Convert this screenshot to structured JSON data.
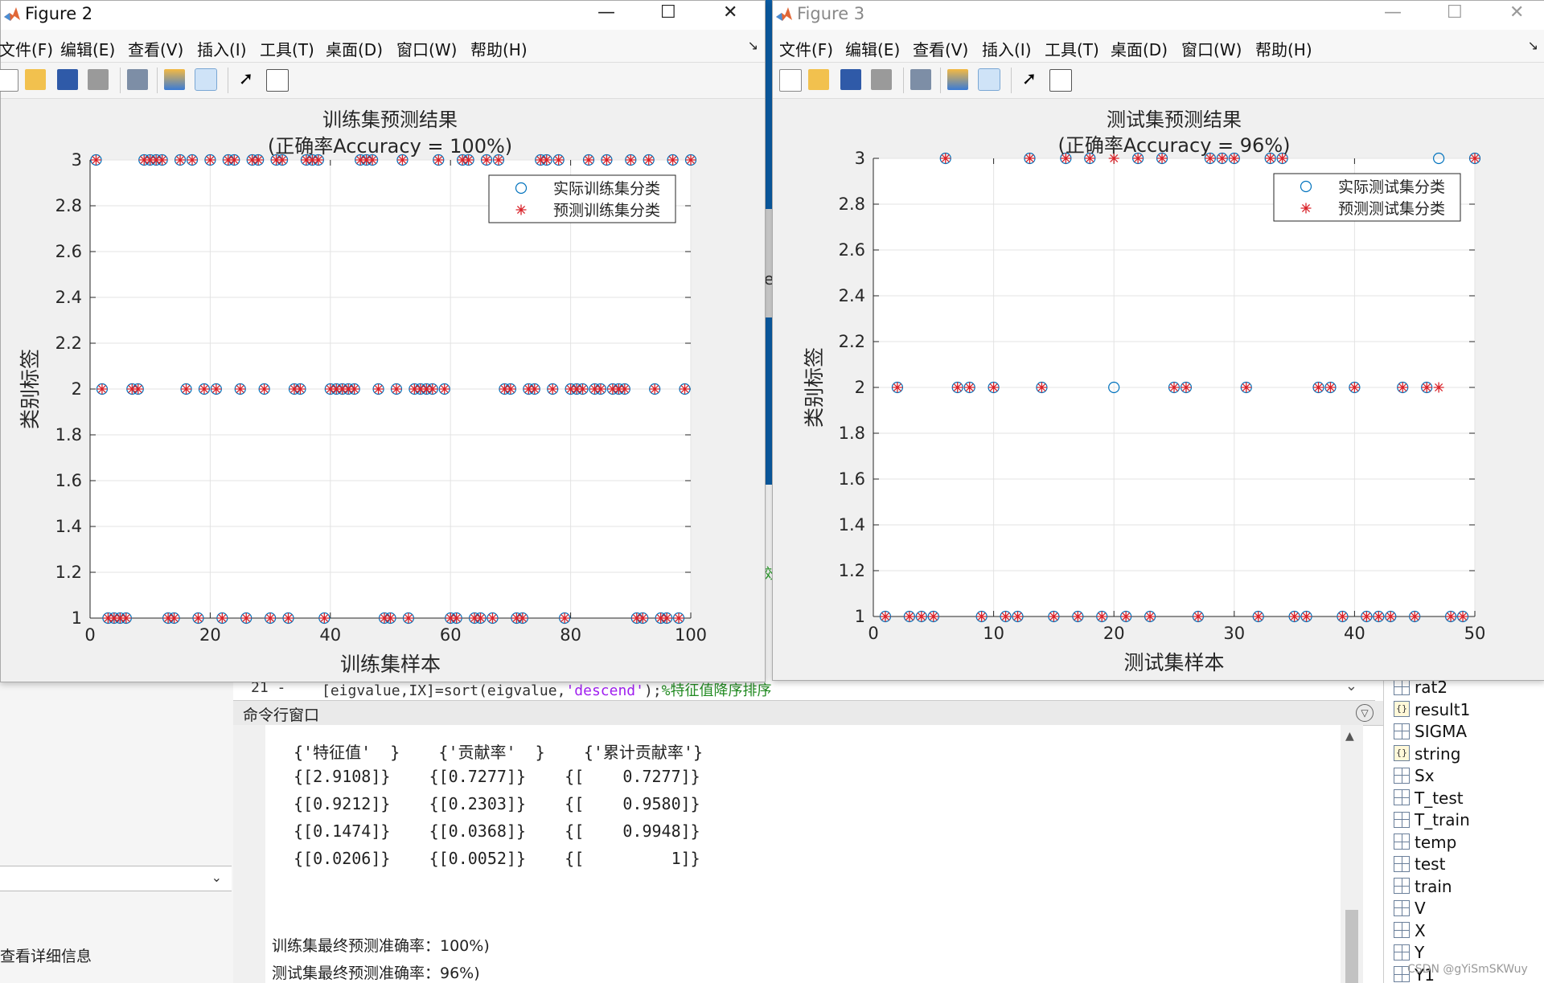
{
  "figures": [
    {
      "window_title": "Figure 2",
      "menu": [
        "文件(F)",
        "编辑(E)",
        "查看(V)",
        "插入(I)",
        "工具(T)",
        "桌面(D)",
        "窗口(W)",
        "帮助(H)"
      ],
      "plot_title_line1": "训练集预测结果",
      "plot_title_line2": "(正确率Accuracy = 100%)",
      "xlabel": "训练集样本",
      "ylabel": "类别标签",
      "legend_actual": "实际训练集分类",
      "legend_predicted": "预测训练集分类"
    },
    {
      "window_title": "Figure 3",
      "menu": [
        "文件(F)",
        "编辑(E)",
        "查看(V)",
        "插入(I)",
        "工具(T)",
        "桌面(D)",
        "窗口(W)",
        "帮助(H)"
      ],
      "plot_title_line1": "测试集预测结果",
      "plot_title_line2": "(正确率Accuracy = 96%)",
      "xlabel": "测试集样本",
      "ylabel": "类别标签",
      "legend_actual": "实际测试集分类",
      "legend_predicted": "预测测试集分类"
    }
  ],
  "chart_data": [
    {
      "type": "scatter",
      "title": "训练集预测结果 (正确率Accuracy = 100%)",
      "xlabel": "训练集样本",
      "ylabel": "类别标签",
      "xlim": [
        0,
        100
      ],
      "ylim": [
        1,
        3
      ],
      "xticks": [
        0,
        20,
        40,
        60,
        80,
        100
      ],
      "yticks": [
        1,
        1.2,
        1.4,
        1.6,
        1.8,
        2,
        2.2,
        2.4,
        2.6,
        2.8,
        3
      ],
      "grid": true,
      "legend_position": "top-right",
      "series": [
        {
          "name": "实际训练集分类",
          "marker": "circle",
          "color": "#0072bd",
          "x": [
            1,
            2,
            3,
            4,
            5,
            6,
            7,
            8,
            9,
            10,
            11,
            12,
            13,
            14,
            15,
            16,
            17,
            18,
            19,
            20,
            21,
            22,
            23,
            24,
            25,
            26,
            27,
            28,
            29,
            30,
            31,
            32,
            33,
            34,
            35,
            36,
            37,
            38,
            39,
            40,
            41,
            42,
            43,
            44,
            45,
            46,
            47,
            48,
            49,
            50,
            51,
            52,
            53,
            54,
            55,
            56,
            57,
            58,
            59,
            60,
            61,
            62,
            63,
            64,
            65,
            66,
            67,
            68,
            69,
            70,
            71,
            72,
            73,
            74,
            75,
            76,
            77,
            78,
            79,
            80,
            81,
            82,
            83,
            84,
            85,
            86,
            87,
            88,
            89,
            90,
            91,
            92,
            93,
            94,
            95,
            96,
            97,
            98,
            99,
            100
          ],
          "y": [
            3,
            2,
            1,
            1,
            1,
            1,
            2,
            2,
            3,
            3,
            3,
            3,
            1,
            1,
            3,
            2,
            3,
            1,
            2,
            3,
            2,
            1,
            3,
            3,
            2,
            1,
            3,
            3,
            2,
            1,
            3,
            3,
            1,
            2,
            2,
            3,
            3,
            3,
            1,
            2,
            2,
            2,
            2,
            2,
            3,
            3,
            3,
            2,
            1,
            1,
            2,
            3,
            1,
            2,
            2,
            2,
            2,
            3,
            2,
            1,
            1,
            3,
            3,
            1,
            1,
            3,
            1,
            3,
            2,
            2,
            1,
            1,
            2,
            2,
            3,
            3,
            2,
            3,
            1,
            2,
            2,
            2,
            3,
            2,
            2,
            3,
            2,
            2,
            2,
            3,
            1,
            1,
            3,
            2,
            1,
            1,
            3,
            1,
            2,
            3
          ]
        },
        {
          "name": "预测训练集分类",
          "marker": "asterisk",
          "color": "#d9232a",
          "x": [
            1,
            2,
            3,
            4,
            5,
            6,
            7,
            8,
            9,
            10,
            11,
            12,
            13,
            14,
            15,
            16,
            17,
            18,
            19,
            20,
            21,
            22,
            23,
            24,
            25,
            26,
            27,
            28,
            29,
            30,
            31,
            32,
            33,
            34,
            35,
            36,
            37,
            38,
            39,
            40,
            41,
            42,
            43,
            44,
            45,
            46,
            47,
            48,
            49,
            50,
            51,
            52,
            53,
            54,
            55,
            56,
            57,
            58,
            59,
            60,
            61,
            62,
            63,
            64,
            65,
            66,
            67,
            68,
            69,
            70,
            71,
            72,
            73,
            74,
            75,
            76,
            77,
            78,
            79,
            80,
            81,
            82,
            83,
            84,
            85,
            86,
            87,
            88,
            89,
            90,
            91,
            92,
            93,
            94,
            95,
            96,
            97,
            98,
            99,
            100
          ],
          "y": [
            3,
            2,
            1,
            1,
            1,
            1,
            2,
            2,
            3,
            3,
            3,
            3,
            1,
            1,
            3,
            2,
            3,
            1,
            2,
            3,
            2,
            1,
            3,
            3,
            2,
            1,
            3,
            3,
            2,
            1,
            3,
            3,
            1,
            2,
            2,
            3,
            3,
            3,
            1,
            2,
            2,
            2,
            2,
            2,
            3,
            3,
            3,
            2,
            1,
            1,
            2,
            3,
            1,
            2,
            2,
            2,
            2,
            3,
            2,
            1,
            1,
            3,
            3,
            1,
            1,
            3,
            1,
            3,
            2,
            2,
            1,
            1,
            2,
            2,
            3,
            3,
            2,
            3,
            1,
            2,
            2,
            2,
            3,
            2,
            2,
            3,
            2,
            2,
            2,
            3,
            1,
            1,
            3,
            2,
            1,
            1,
            3,
            1,
            2,
            3
          ]
        }
      ]
    },
    {
      "type": "scatter",
      "title": "测试集预测结果 (正确率Accuracy = 96%)",
      "xlabel": "测试集样本",
      "ylabel": "类别标签",
      "xlim": [
        0,
        50
      ],
      "ylim": [
        1,
        3
      ],
      "xticks": [
        0,
        10,
        20,
        30,
        40,
        50
      ],
      "yticks": [
        1,
        1.2,
        1.4,
        1.6,
        1.8,
        2,
        2.2,
        2.4,
        2.6,
        2.8,
        3
      ],
      "grid": true,
      "legend_position": "top-right",
      "series": [
        {
          "name": "实际测试集分类",
          "marker": "circle",
          "color": "#0072bd",
          "x": [
            1,
            2,
            3,
            4,
            5,
            6,
            7,
            8,
            9,
            10,
            11,
            12,
            13,
            14,
            15,
            16,
            17,
            18,
            19,
            20,
            21,
            22,
            23,
            24,
            25,
            26,
            27,
            28,
            29,
            30,
            31,
            32,
            33,
            34,
            35,
            36,
            37,
            38,
            39,
            40,
            41,
            42,
            43,
            44,
            45,
            46,
            47,
            48,
            49,
            50
          ],
          "y": [
            1,
            2,
            1,
            1,
            1,
            3,
            2,
            2,
            1,
            2,
            1,
            1,
            3,
            2,
            1,
            3,
            1,
            3,
            1,
            2,
            1,
            3,
            1,
            3,
            2,
            2,
            1,
            3,
            3,
            3,
            2,
            1,
            3,
            3,
            1,
            1,
            2,
            2,
            1,
            2,
            1,
            1,
            1,
            2,
            1,
            2,
            3,
            1,
            1,
            3
          ]
        },
        {
          "name": "预测测试集分类",
          "marker": "asterisk",
          "color": "#d9232a",
          "x": [
            1,
            2,
            3,
            4,
            5,
            6,
            7,
            8,
            9,
            10,
            11,
            12,
            13,
            14,
            15,
            16,
            17,
            18,
            19,
            20,
            21,
            22,
            23,
            24,
            25,
            26,
            27,
            28,
            29,
            30,
            31,
            32,
            33,
            34,
            35,
            36,
            37,
            38,
            39,
            40,
            41,
            42,
            43,
            44,
            45,
            46,
            47,
            48,
            49,
            50
          ],
          "y": [
            1,
            2,
            1,
            1,
            1,
            3,
            2,
            2,
            1,
            2,
            1,
            1,
            3,
            2,
            1,
            3,
            1,
            3,
            1,
            3,
            1,
            3,
            1,
            3,
            2,
            2,
            1,
            3,
            3,
            3,
            2,
            1,
            3,
            3,
            1,
            1,
            2,
            2,
            1,
            2,
            1,
            1,
            1,
            2,
            1,
            2,
            2,
            1,
            1,
            3
          ]
        }
      ]
    }
  ],
  "editor": {
    "line_number": "21 -",
    "code_prefix": "[eigvalue,IX]=sort(eigvalue,",
    "code_string": "'descend'",
    "code_suffix": ");",
    "code_comment": "%特征值降序排序"
  },
  "command_window": {
    "title": "命令行窗口",
    "table_rows": [
      "{'特征值'  }    {'贡献率'  }    {'累计贡献率'}",
      "{[2.9108]}    {[0.7277]}    {[    0.7277]}",
      "{[0.9212]}    {[0.2303]}    {[    0.9580]}",
      "{[0.1474]}    {[0.0368]}    {[    0.9948]}",
      "{[0.0206]}    {[0.0052]}    {[         1]}"
    ],
    "train_msg": "训练集最终预测准确率：100%)",
    "test_msg": "测试集最终预测准确率：96%)"
  },
  "left_panel": {
    "detail_text": "查看详细信息"
  },
  "workspace": {
    "items": [
      {
        "name": "rat2",
        "struct": false
      },
      {
        "name": "result1",
        "struct": true
      },
      {
        "name": "SIGMA",
        "struct": false
      },
      {
        "name": "string",
        "struct": true
      },
      {
        "name": "Sx",
        "struct": false
      },
      {
        "name": "T_test",
        "struct": false
      },
      {
        "name": "T_train",
        "struct": false
      },
      {
        "name": "temp",
        "struct": false
      },
      {
        "name": "test",
        "struct": false
      },
      {
        "name": "train",
        "struct": false
      },
      {
        "name": "V",
        "struct": false
      },
      {
        "name": "X",
        "struct": false
      },
      {
        "name": "Y",
        "struct": false
      },
      {
        "name": "Y1",
        "struct": false
      }
    ]
  },
  "watermark": "CSDN @gYiSmSKWuy",
  "background_fragments": {
    "mid_text": "ec",
    "mid_text2": "效"
  },
  "colors": {
    "actual_marker": "#0072bd",
    "predicted_marker": "#d9232a",
    "matlab_blue": "#0b5ea8"
  }
}
